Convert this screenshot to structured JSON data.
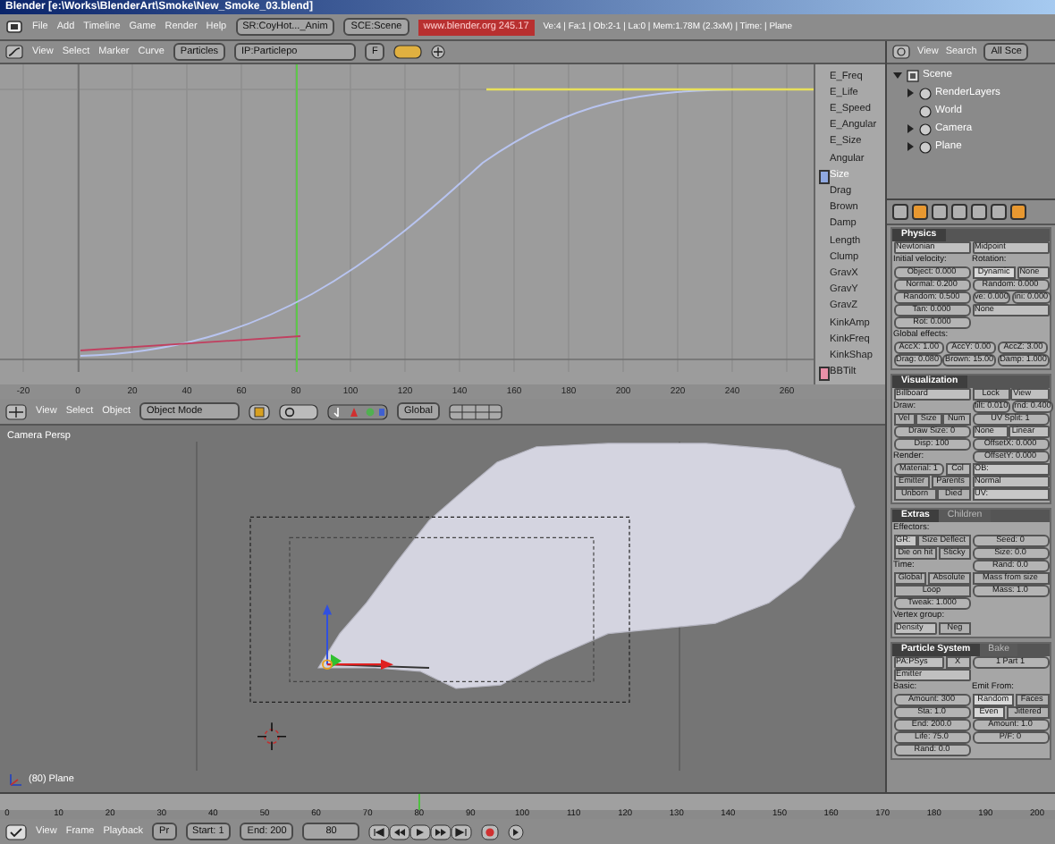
{
  "window": {
    "title": "Blender [e:\\Works\\BlenderArt\\Smoke\\New_Smoke_03.blend]"
  },
  "top_bar": {
    "menus": [
      "File",
      "Add",
      "Timeline",
      "Game",
      "Render",
      "Help"
    ],
    "screen_field": "SR:CoyHot..._Anim",
    "scene_field": "SCE:Scene",
    "version": "www.blender.org 245.17",
    "stats": "Ve:4 | Fa:1 | Ob:2-1 | La:0 | Mem:1.78M (2.3xM) | Time: | Plane"
  },
  "ipo_editor": {
    "menus": [
      "View",
      "Select",
      "Marker",
      "Curve"
    ],
    "type_menu": "Particles",
    "block_field": "IP:Particlepo",
    "fake_user": "F",
    "channels": [
      {
        "label": "E_Freq",
        "selected": false
      },
      {
        "label": "E_Life",
        "selected": false
      },
      {
        "label": "E_Speed",
        "selected": false
      },
      {
        "label": "E_Angular",
        "selected": false
      },
      {
        "label": "E_Size",
        "selected": false
      },
      {
        "label": "Angular",
        "selected": false
      },
      {
        "label": "Size",
        "selected": true,
        "color": "#8fa8e0"
      },
      {
        "label": "Drag",
        "selected": false
      },
      {
        "label": "Brown",
        "selected": false
      },
      {
        "label": "Damp",
        "selected": false
      },
      {
        "label": "Length",
        "selected": false
      },
      {
        "label": "Clump",
        "selected": false
      },
      {
        "label": "GravX",
        "selected": false
      },
      {
        "label": "GravY",
        "selected": false
      },
      {
        "label": "GravZ",
        "selected": false
      },
      {
        "label": "KinkAmp",
        "selected": false
      },
      {
        "label": "KinkFreq",
        "selected": false
      },
      {
        "label": "KinkShap",
        "selected": false
      },
      {
        "label": "BBTilt",
        "selected": false,
        "color": "#e890a8"
      }
    ],
    "ruler": [
      "-20",
      "0",
      "20",
      "40",
      "60",
      "80",
      "100",
      "120",
      "140",
      "160",
      "180",
      "200",
      "220",
      "240",
      "260"
    ]
  },
  "outliner": {
    "menus": [
      "View",
      "Search"
    ],
    "display_menu": "All Sce",
    "tree": [
      {
        "label": "Scene",
        "expanded": true,
        "children": [
          {
            "label": "RenderLayers",
            "expanded": false
          },
          {
            "label": "World"
          },
          {
            "label": "Camera",
            "expanded": false
          },
          {
            "label": "Plane",
            "expanded": false
          }
        ]
      }
    ]
  },
  "buttons_window": {
    "context_buttons": [
      {
        "selected": false
      },
      {
        "selected": true
      },
      {
        "selected": false
      },
      {
        "selected": false
      },
      {
        "selected": false
      },
      {
        "selected": false
      },
      {
        "selected": true
      }
    ],
    "panels": [
      {
        "tabs": [
          {
            "text": "Physics",
            "selected": true
          }
        ],
        "rows": [
          {
            "left": [
              {
                "kind": "menu",
                "text": "Newtonian"
              }
            ],
            "right": [
              {
                "kind": "menu",
                "text": "Midpoint"
              }
            ]
          },
          {
            "left": [
              {
                "kind": "label",
                "text": "Initial velocity:"
              }
            ],
            "right": [
              {
                "kind": "label",
                "text": "Rotation:"
              }
            ]
          },
          {
            "left": [
              {
                "kind": "num",
                "text": "Object: 0.000"
              }
            ],
            "right": [
              {
                "kind": "toggle",
                "text": "Dynamic",
                "selected": true
              },
              {
                "kind": "menu",
                "text": "None"
              }
            ]
          },
          {
            "left": [
              {
                "kind": "num",
                "text": "Normal: 0.200"
              }
            ],
            "right": [
              {
                "kind": "num",
                "text": "Random: 0.000"
              }
            ]
          },
          {
            "left": [
              {
                "kind": "num",
                "text": "Random: 0.500"
              }
            ],
            "right": [
              {
                "kind": "num",
                "text": "ve: 0.000"
              },
              {
                "kind": "num",
                "text": "ini: 0.000"
              }
            ]
          },
          {
            "left": [
              {
                "kind": "num",
                "text": "Tan: 0.000"
              }
            ],
            "right": [
              {
                "kind": "menu",
                "text": "None"
              }
            ]
          },
          {
            "left": [
              {
                "kind": "num",
                "text": "Rot: 0.000"
              }
            ]
          },
          {
            "cells": [
              {
                "kind": "label",
                "text": "Global effects:"
              }
            ]
          },
          {
            "cells": [
              {
                "kind": "num",
                "text": "AccX: 1.00"
              },
              {
                "kind": "num",
                "text": "AccY: 0.00"
              },
              {
                "kind": "num",
                "text": "AccZ: 3.00"
              }
            ]
          },
          {
            "cells": [
              {
                "kind": "num",
                "text": "Drag: 0.080"
              },
              {
                "kind": "num",
                "text": "Brown: 15.00"
              },
              {
                "kind": "num",
                "text": "Damp: 1.000"
              }
            ]
          }
        ]
      },
      {
        "tabs": [
          {
            "text": "Visualization",
            "selected": true
          }
        ],
        "rows": [
          {
            "left": [
              {
                "kind": "menu",
                "text": "Billboard"
              }
            ],
            "right": [
              {
                "kind": "button",
                "text": "Lock"
              },
              {
                "kind": "menu",
                "text": "View"
              }
            ]
          },
          {
            "left": [
              {
                "kind": "label",
                "text": "Draw:"
              }
            ],
            "right": [
              {
                "kind": "num",
                "text": "tilt: 0.010"
              },
              {
                "kind": "num",
                "text": "rnd: 0.400"
              }
            ]
          },
          {
            "left": [
              {
                "kind": "toggle",
                "text": "Vel",
                "selected": false
              },
              {
                "kind": "toggle",
                "text": "Size",
                "selected": false
              },
              {
                "kind": "toggle",
                "text": "Num",
                "selected": false
              }
            ],
            "right": [
              {
                "kind": "num",
                "text": "UV Split: 1"
              }
            ]
          },
          {
            "left": [
              {
                "kind": "num",
                "text": "Draw Size: 0"
              }
            ],
            "right": [
              {
                "kind": "menu",
                "text": "None"
              },
              {
                "kind": "menu",
                "text": "Linear"
              }
            ]
          },
          {
            "left": [
              {
                "kind": "num",
                "text": "Disp: 100"
              }
            ],
            "right": [
              {
                "kind": "num",
                "text": "OffsetX: 0.000"
              }
            ]
          },
          {
            "left": [
              {
                "kind": "label",
                "text": "Render:"
              }
            ],
            "right": [
              {
                "kind": "num",
                "text": "OffsetY: 0.000"
              }
            ]
          },
          {
            "left": [
              {
                "kind": "num",
                "text": "Material: 1"
              },
              {
                "kind": "button",
                "text": "Col"
              }
            ],
            "right": [
              {
                "kind": "field",
                "text": "OB:"
              }
            ]
          },
          {
            "left": [
              {
                "kind": "toggle",
                "text": "Emitter",
                "selected": false
              },
              {
                "kind": "toggle",
                "text": "Parents",
                "selected": false
              }
            ],
            "right": [
              {
                "kind": "menu",
                "text": "Normal"
              }
            ]
          },
          {
            "left": [
              {
                "kind": "toggle",
                "text": "Unborn",
                "selected": false
              },
              {
                "kind": "toggle",
                "text": "Died",
                "selected": false
              }
            ],
            "right": [
              {
                "kind": "field",
                "text": "UV:"
              }
            ]
          }
        ]
      },
      {
        "tabs": [
          {
            "text": "Extras",
            "selected": true
          },
          {
            "text": "Children",
            "selected": false
          }
        ],
        "rows": [
          {
            "left": [
              {
                "kind": "label",
                "text": "Effectors:"
              }
            ]
          },
          {
            "left": [
              {
                "kind": "field",
                "text": "GR:"
              },
              {
                "kind": "toggle",
                "text": "Size Deflect",
                "selected": false
              }
            ],
            "right": [
              {
                "kind": "num",
                "text": "Seed: 0"
              }
            ]
          },
          {
            "left": [
              {
                "kind": "toggle",
                "text": "Die on hit",
                "selected": false
              },
              {
                "kind": "toggle",
                "text": "Sticky",
                "selected": false
              }
            ],
            "right": [
              {
                "kind": "num",
                "text": "Size: 0.0"
              }
            ]
          },
          {
            "left": [
              {
                "kind": "label",
                "text": "Time:"
              }
            ],
            "right": [
              {
                "kind": "num",
                "text": "Rand: 0.0"
              }
            ]
          },
          {
            "left": [
              {
                "kind": "toggle",
                "text": "Global",
                "selected": false
              },
              {
                "kind": "toggle",
                "text": "Absolute",
                "selected": false
              }
            ],
            "right": [
              {
                "kind": "toggle",
                "text": "Mass from size",
                "selected": false
              }
            ]
          },
          {
            "left": [
              {
                "kind": "toggle",
                "text": "Loop",
                "selected": false
              }
            ],
            "right": [
              {
                "kind": "num",
                "text": "Mass: 1.0"
              }
            ]
          },
          {
            "left": [
              {
                "kind": "num",
                "text": "Tweak: 1.000"
              }
            ]
          },
          {
            "left": [
              {
                "kind": "label",
                "text": "Vertex group:"
              }
            ]
          },
          {
            "left": [
              {
                "kind": "menu",
                "text": "Density"
              },
              {
                "kind": "toggle",
                "text": "Neg",
                "selected": false
              }
            ]
          }
        ]
      },
      {
        "tabs": [
          {
            "text": "Particle System",
            "selected": true
          },
          {
            "text": "Bake",
            "selected": false
          }
        ],
        "rows": [
          {
            "left": [
              {
                "kind": "menu",
                "text": "PA:PSys"
              },
              {
                "kind": "button",
                "text": "X"
              }
            ],
            "right": [
              {
                "kind": "num",
                "text": "1 Part 1"
              }
            ]
          },
          {
            "left": [
              {
                "kind": "menu",
                "text": "Emitter"
              }
            ]
          },
          {
            "left": [
              {
                "kind": "label",
                "text": "Basic:"
              }
            ],
            "right": [
              {
                "kind": "label",
                "text": "Emit From:"
              }
            ]
          },
          {
            "left": [
              {
                "kind": "num",
                "text": "Amount: 300"
              }
            ],
            "right": [
              {
                "kind": "toggle",
                "text": "Random",
                "selected": true
              },
              {
                "kind": "toggle",
                "text": "Faces",
                "selected": false
              }
            ]
          },
          {
            "left": [
              {
                "kind": "num",
                "text": "Sta: 1.0"
              }
            ],
            "right": [
              {
                "kind": "toggle",
                "text": "Even",
                "selected": true
              },
              {
                "kind": "toggle",
                "text": "Jittered",
                "selected": false
              }
            ]
          },
          {
            "left": [
              {
                "kind": "num",
                "text": "End: 200.0"
              }
            ],
            "right": [
              {
                "kind": "num",
                "text": "Amount: 1.0"
              }
            ]
          },
          {
            "left": [
              {
                "kind": "num",
                "text": "Life: 75.0"
              }
            ],
            "right": [
              {
                "kind": "num",
                "text": "P/F: 0"
              }
            ]
          },
          {
            "left": [
              {
                "kind": "num",
                "text": "Rand: 0.0"
              }
            ]
          }
        ]
      }
    ]
  },
  "view3d": {
    "menus": [
      "View",
      "Select",
      "Object"
    ],
    "mode_menu": "Object Mode",
    "orientation_menu": "Global",
    "view_label": "Camera Persp",
    "object_label": "(80) Plane"
  },
  "timeline": {
    "ruler": [
      "0",
      "10",
      "20",
      "30",
      "40",
      "50",
      "60",
      "70",
      "80",
      "90",
      "100",
      "110",
      "120",
      "130",
      "140",
      "150",
      "160",
      "170",
      "180",
      "190",
      "200"
    ],
    "menus": [
      "View",
      "Frame",
      "Playback"
    ],
    "preview_button": "Pr",
    "start_field": "Start: 1",
    "end_field": "End: 200",
    "frame_field": "80"
  }
}
